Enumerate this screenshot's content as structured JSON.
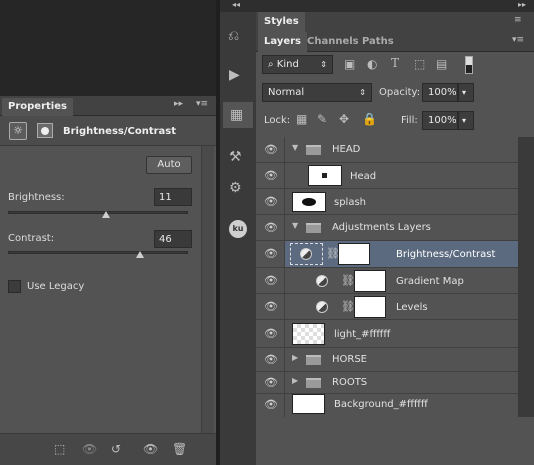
{
  "styles_panel": {
    "tab_label": "Styles"
  },
  "layers_panel": {
    "tabs": [
      {
        "label": "Layers",
        "active": true
      },
      {
        "label": "Channels",
        "active": false
      },
      {
        "label": "Paths",
        "active": false
      }
    ],
    "filter_kind": "Kind",
    "blend_mode": "Normal",
    "opacity_label": "Opacity:",
    "opacity_value": "100%",
    "lock_label": "Lock:",
    "fill_label": "Fill:",
    "fill_value": "100%",
    "layers": [
      {
        "name": "HEAD",
        "type": "group",
        "expanded": true,
        "indent": 0
      },
      {
        "name": "Head",
        "type": "pixel",
        "indent": 1
      },
      {
        "name": "splash",
        "type": "pixel",
        "indent": 0
      },
      {
        "name": "Adjustments Layers",
        "type": "group",
        "expanded": true,
        "indent": 0
      },
      {
        "name": "Brightness/Contrast",
        "type": "adjustment",
        "indent": 1,
        "selected": true
      },
      {
        "name": "Gradient Map",
        "type": "adjustment",
        "indent": 1
      },
      {
        "name": "Levels",
        "type": "adjustment",
        "indent": 1
      },
      {
        "name": "light_#ffffff",
        "type": "pixel",
        "indent": 0
      },
      {
        "name": "HORSE",
        "type": "group",
        "expanded": false,
        "indent": 0
      },
      {
        "name": "ROOTS",
        "type": "group",
        "expanded": false,
        "indent": 0
      },
      {
        "name": "Background_#ffffff",
        "type": "pixel",
        "indent": 0
      }
    ]
  },
  "properties_panel": {
    "tab_label": "Properties",
    "adjustment_title": "Brightness/Contrast",
    "auto_label": "Auto",
    "brightness_label": "Brightness:",
    "brightness_value": "11",
    "contrast_label": "Contrast:",
    "contrast_value": "46",
    "use_legacy_label": "Use Legacy",
    "use_legacy_checked": false
  },
  "colors": {
    "selected_row": "#5b6a7e",
    "panel_bg": "#535353"
  }
}
